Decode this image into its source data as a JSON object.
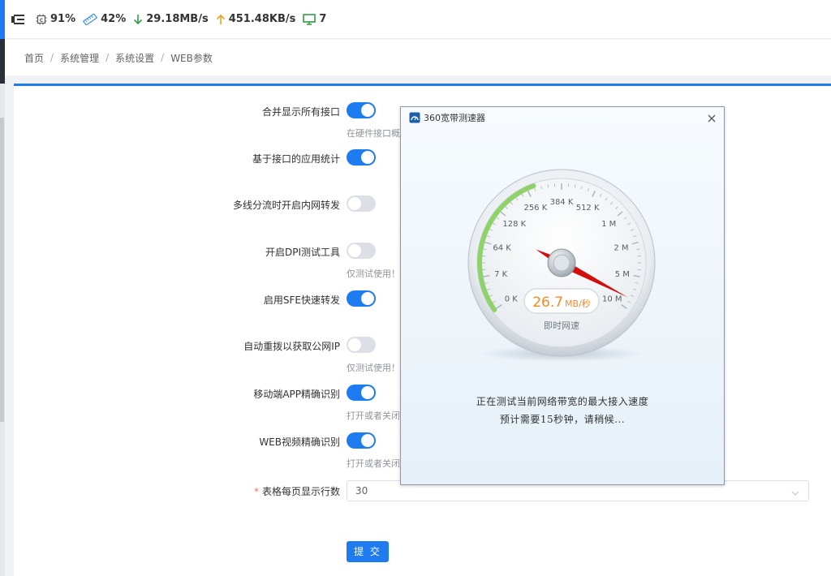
{
  "header": {
    "cpu": "91%",
    "memory": "42%",
    "download": "29.18MB/s",
    "upload": "451.48KB/s",
    "terminals": "7"
  },
  "breadcrumb": [
    "首页",
    "系统管理",
    "系统设置",
    "WEB参数"
  ],
  "settings": [
    {
      "label": "合并显示所有接口",
      "on": true,
      "hint": "在硬件接口概"
    },
    {
      "label": "基于接口的应用统计",
      "on": true,
      "hint": ""
    },
    {
      "label": "多线分流时开启内网转发",
      "on": false,
      "hint": ""
    },
    {
      "label": "开启DPI测试工具",
      "on": false,
      "hint": "仅测试使用！"
    },
    {
      "label": "启用SFE快速转发",
      "on": true,
      "hint": ""
    },
    {
      "label": "自动重拨以获取公网IP",
      "on": false,
      "hint": "仅测试使用！"
    },
    {
      "label": "移动端APP精确识别",
      "on": true,
      "hint": "打开或者关闭"
    },
    {
      "label": "WEB视频精确识别",
      "on": true,
      "hint": "打开或者关闭"
    }
  ],
  "rows_per_page": {
    "required_mark": "*",
    "label": "表格每页显示行数",
    "value": "30"
  },
  "submit_label": "提 交",
  "speedtest": {
    "title": "360宽带测速器",
    "gauge_ticks": [
      "0 K",
      "7 K",
      "64 K",
      "128 K",
      "256 K",
      "384 K",
      "512 K",
      "1 M",
      "2 M",
      "5 M",
      "10 M"
    ],
    "speed_value": "26.7",
    "speed_unit": "MB/秒",
    "speed_caption": "即时网速",
    "message_line1": "正在测试当前网络带宽的最大接入速度",
    "message_line2": "预计需要15秒钟，请稍候..."
  },
  "colors": {
    "accent": "#1f7cf0",
    "switch_off": "#dcdfe6",
    "needle": "#d40d0d",
    "speed_text": "#f08a24",
    "gauge_arc": "#8fd16a"
  }
}
